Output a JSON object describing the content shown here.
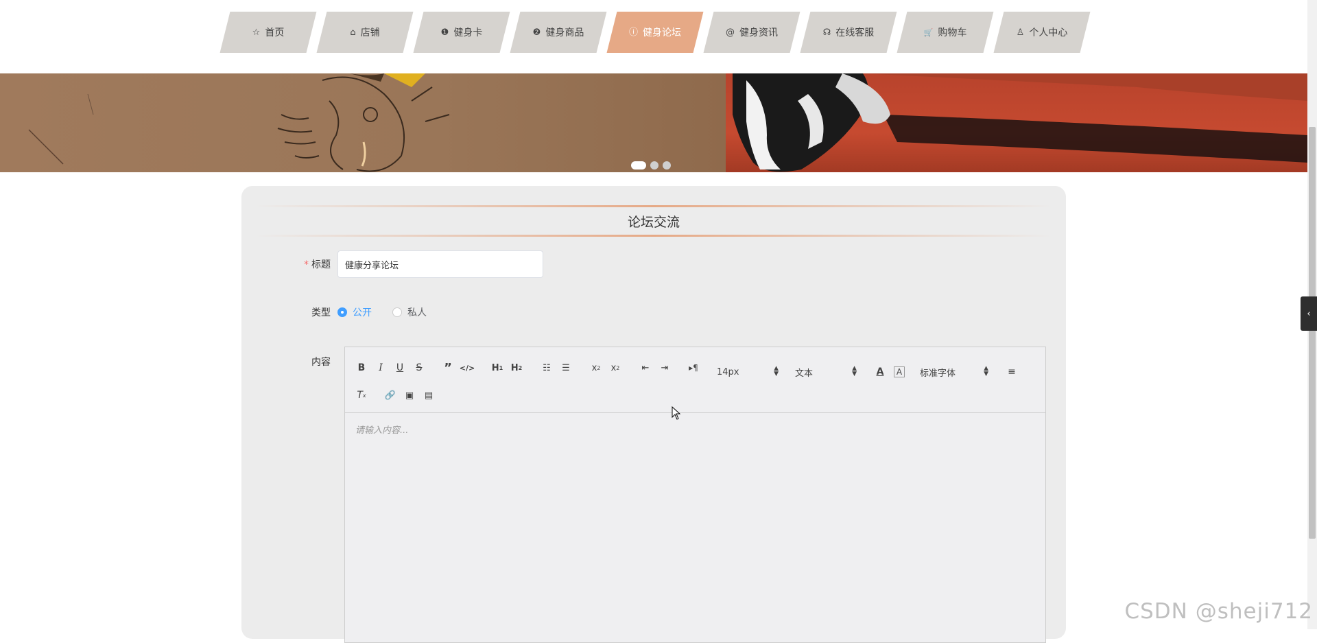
{
  "nav": {
    "items": [
      {
        "label": "首页",
        "icon": "star-icon",
        "glyph": "☆"
      },
      {
        "label": "店铺",
        "icon": "shop-bag-icon",
        "glyph": "⌂"
      },
      {
        "label": "健身卡",
        "icon": "alert-circle-icon",
        "glyph": "❶"
      },
      {
        "label": "健身商品",
        "icon": "question-circle-icon",
        "glyph": "❷"
      },
      {
        "label": "健身论坛",
        "icon": "info-circle-icon",
        "glyph": "ⓘ"
      },
      {
        "label": "健身资讯",
        "icon": "at-icon",
        "glyph": "@"
      },
      {
        "label": "在线客服",
        "icon": "headset-icon",
        "glyph": "☊"
      },
      {
        "label": "购物车",
        "icon": "cart-icon",
        "glyph": "🛒"
      },
      {
        "label": "个人中心",
        "icon": "user-icon",
        "glyph": "♙"
      }
    ],
    "active_index": 4
  },
  "panel": {
    "title": "论坛交流",
    "fields": {
      "title_label": "标题",
      "title_value": "健康分享论坛",
      "type_label": "类型",
      "type_options": [
        "公开",
        "私人"
      ],
      "type_selected": "公开",
      "content_label": "内容"
    }
  },
  "editor": {
    "font_size": "14px",
    "block_format": "文本",
    "font_family": "标准字体",
    "placeholder": "请输入内容..."
  },
  "watermark": "CSDN @sheji712",
  "colors": {
    "nav_active": "#e6a986",
    "nav_default": "#d6d3cf",
    "accent_blue": "#409eff",
    "required_red": "#f56c6c"
  }
}
